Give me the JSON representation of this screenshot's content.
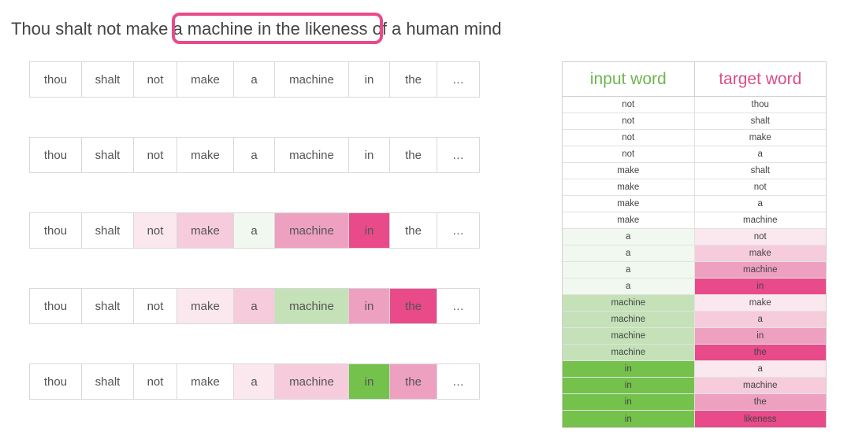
{
  "sentence": "Thou shalt not make a machine in the likeness of a human mind",
  "words": [
    "thou",
    "shalt",
    "not",
    "make",
    "a",
    "machine",
    "in",
    "the",
    "…"
  ],
  "cell_widths": [
    "w-thou",
    "w-shalt",
    "w-not",
    "w-make",
    "w-a",
    "w-machine",
    "w-in",
    "w-the",
    "w-ell"
  ],
  "rows": [
    {
      "colors": [
        "",
        "",
        "",
        "",
        "",
        "",
        "",
        "",
        ""
      ]
    },
    {
      "colors": [
        "",
        "",
        "",
        "",
        "",
        "",
        "",
        "",
        ""
      ]
    },
    {
      "colors": [
        "",
        "",
        "pink1",
        "pink2",
        "green0",
        "pink3",
        "pink4",
        "",
        ""
      ]
    },
    {
      "colors": [
        "",
        "",
        "",
        "pink1",
        "pink2",
        "green2",
        "pink3",
        "pink4",
        ""
      ]
    },
    {
      "colors": [
        "",
        "",
        "",
        "",
        "pink1",
        "pink2",
        "green4",
        "pink3",
        ""
      ]
    }
  ],
  "table": {
    "header_input": "input word",
    "header_target": "target word",
    "rows": [
      {
        "in": "not",
        "tg": "thou",
        "ic": "",
        "tc": ""
      },
      {
        "in": "not",
        "tg": "shalt",
        "ic": "",
        "tc": ""
      },
      {
        "in": "not",
        "tg": "make",
        "ic": "",
        "tc": ""
      },
      {
        "in": "not",
        "tg": "a",
        "ic": "",
        "tc": ""
      },
      {
        "in": "make",
        "tg": "shalt",
        "ic": "",
        "tc": ""
      },
      {
        "in": "make",
        "tg": "not",
        "ic": "",
        "tc": ""
      },
      {
        "in": "make",
        "tg": "a",
        "ic": "",
        "tc": ""
      },
      {
        "in": "make",
        "tg": "machine",
        "ic": "",
        "tc": ""
      },
      {
        "in": "a",
        "tg": "not",
        "ic": "green0",
        "tc": "pink1"
      },
      {
        "in": "a",
        "tg": "make",
        "ic": "green0",
        "tc": "pink2"
      },
      {
        "in": "a",
        "tg": "machine",
        "ic": "green0",
        "tc": "pink3"
      },
      {
        "in": "a",
        "tg": "in",
        "ic": "green0",
        "tc": "pink4"
      },
      {
        "in": "machine",
        "tg": "make",
        "ic": "green2",
        "tc": "pink1"
      },
      {
        "in": "machine",
        "tg": "a",
        "ic": "green2",
        "tc": "pink2"
      },
      {
        "in": "machine",
        "tg": "in",
        "ic": "green2",
        "tc": "pink3"
      },
      {
        "in": "machine",
        "tg": "the",
        "ic": "green2",
        "tc": "pink4"
      },
      {
        "in": "in",
        "tg": "a",
        "ic": "green4",
        "tc": "pink1"
      },
      {
        "in": "in",
        "tg": "machine",
        "ic": "green4",
        "tc": "pink2"
      },
      {
        "in": "in",
        "tg": "the",
        "ic": "green4",
        "tc": "pink3"
      },
      {
        "in": "in",
        "tg": "likeness",
        "ic": "green4",
        "tc": "pink4"
      }
    ]
  }
}
